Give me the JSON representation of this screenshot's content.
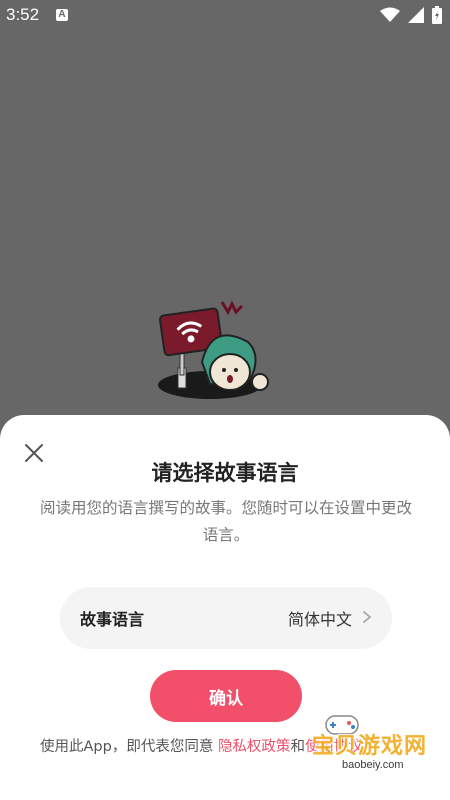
{
  "status": {
    "time": "3:52",
    "notification_icon": "a-icon",
    "wifi_icon": "wifi-icon",
    "signal_icon": "signal-icon",
    "battery_icon": "battery-icon"
  },
  "sheet": {
    "close_icon": "close-icon",
    "title": "请选择故事语言",
    "description": "阅读用您的语言撰写的故事。您随时可以在设置中更改语言。",
    "language_label": "故事语言",
    "language_value": "简体中文",
    "confirm": "确认",
    "agreement_prefix": "使用此App，即代表您同意",
    "privacy_link": "隐私权政策",
    "and": "和",
    "terms_link": "使用协议"
  },
  "watermark": {
    "text": "宝贝游戏网",
    "url": "baobeiy.com"
  },
  "colors": {
    "accent": "#f2506a",
    "overlay": "#676767"
  }
}
